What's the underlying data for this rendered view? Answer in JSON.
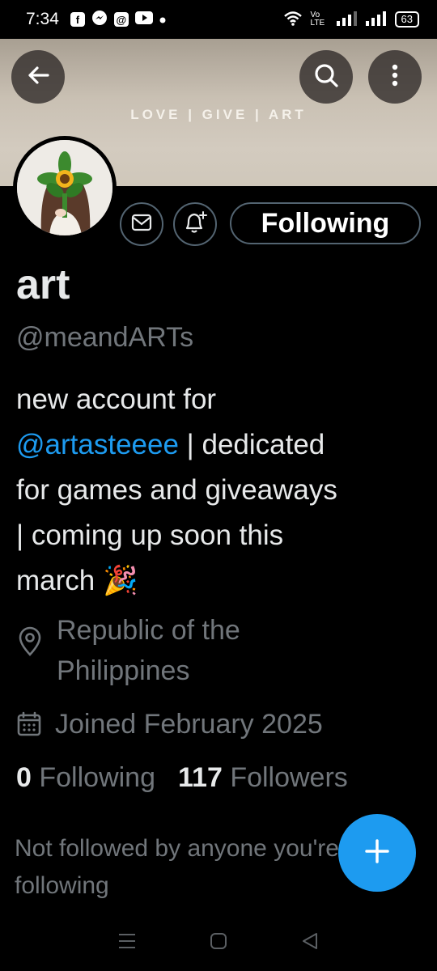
{
  "status_bar": {
    "time": "7:34",
    "notification_icons": [
      "facebook-icon",
      "messenger-icon",
      "threads-icon",
      "youtube-icon",
      "dot-icon"
    ],
    "network_label": "Vo LTE",
    "battery": "63"
  },
  "banner": {
    "text": "LOVE | GIVE | ART"
  },
  "profile": {
    "display_name": "art",
    "handle": "@meandARTs",
    "bio_line1": "new account for",
    "bio_mention": "@artasteeee",
    "bio_rest1": " | dedicated",
    "bio_line3": "for games and giveaways",
    "bio_line4": "| coming up soon this",
    "bio_line5": "march",
    "bio_emoji": "🎉",
    "location": "Republic of the Philippines",
    "joined": "Joined February 2025",
    "following_count": "0",
    "following_label": "Following",
    "followers_count": "117",
    "followers_label": "Followers",
    "not_followed": "Not followed by anyone you're following"
  },
  "actions": {
    "following_button": "Following"
  },
  "colors": {
    "accent": "#1d9bf0",
    "muted": "#71767b",
    "text": "#e7e9ea",
    "border": "#536471"
  }
}
